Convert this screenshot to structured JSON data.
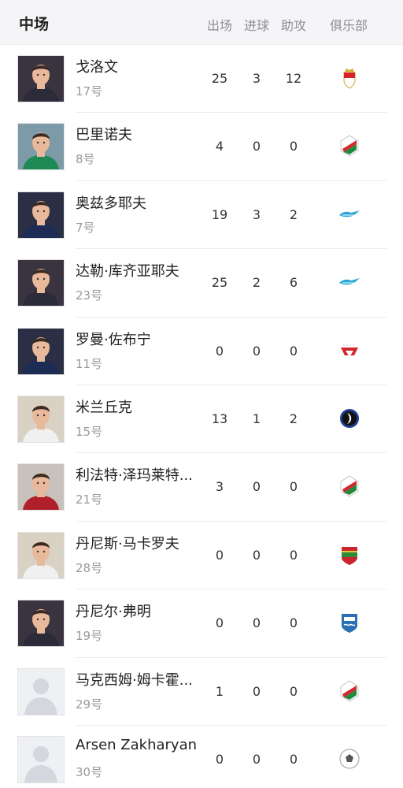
{
  "header": {
    "title": "中场",
    "col_apps": "出场",
    "col_goals": "进球",
    "col_assists": "助攻",
    "col_club": "俱乐部"
  },
  "players": [
    {
      "name": "戈洛文",
      "number": "17号",
      "apps": "25",
      "goals": "3",
      "assists": "12",
      "club_icon": "monaco-crest-icon",
      "photo": "dark"
    },
    {
      "name": "巴里诺夫",
      "number": "8号",
      "apps": "4",
      "goals": "0",
      "assists": "0",
      "club_icon": "lokomotiv-crest-icon",
      "photo": "green"
    },
    {
      "name": "奥兹多耶夫",
      "number": "7号",
      "apps": "19",
      "goals": "3",
      "assists": "2",
      "club_icon": "zenit-crest-icon",
      "photo": "navy"
    },
    {
      "name": "达勒·库齐亚耶夫",
      "number": "23号",
      "apps": "25",
      "goals": "2",
      "assists": "6",
      "club_icon": "zenit-crest-icon",
      "photo": "dark"
    },
    {
      "name": "罗曼·佐布宁",
      "number": "11号",
      "apps": "0",
      "goals": "0",
      "assists": "0",
      "club_icon": "spartak-crest-icon",
      "photo": "navy"
    },
    {
      "name": "米兰丘克",
      "number": "15号",
      "apps": "13",
      "goals": "1",
      "assists": "2",
      "club_icon": "atalanta-crest-icon",
      "photo": "white"
    },
    {
      "name": "利法特·泽玛莱特...",
      "number": "21号",
      "apps": "3",
      "goals": "0",
      "assists": "0",
      "club_icon": "lokomotiv-crest-icon",
      "photo": "red"
    },
    {
      "name": "丹尼斯·马卡罗夫",
      "number": "28号",
      "apps": "0",
      "goals": "0",
      "assists": "0",
      "club_icon": "rubin-crest-icon",
      "photo": "white"
    },
    {
      "name": "丹尼尔·弗明",
      "number": "19号",
      "apps": "0",
      "goals": "0",
      "assists": "0",
      "club_icon": "volga-crest-icon",
      "photo": "dark"
    },
    {
      "name": "马克西姆·姆卡霍...",
      "number": "29号",
      "apps": "1",
      "goals": "0",
      "assists": "0",
      "club_icon": "lokomotiv-crest-icon",
      "photo": "placeholder"
    },
    {
      "name": "Arsen Zakharyan",
      "number": "30号",
      "apps": "0",
      "goals": "0",
      "assists": "0",
      "club_icon": "soccer-ball-icon",
      "photo": "placeholder"
    }
  ],
  "colors": {
    "monaco_red": "#d6202a",
    "lokomotiv_red": "#d7262e",
    "lokomotiv_green": "#1f8a3b",
    "zenit_blue": "#2aa7d8",
    "spartak_red": "#d3262c",
    "atalanta_blue": "#1d3d8f",
    "rubin_red": "#c8262c",
    "rubin_green": "#2f8a3a",
    "volga_blue": "#2b6fb5"
  }
}
